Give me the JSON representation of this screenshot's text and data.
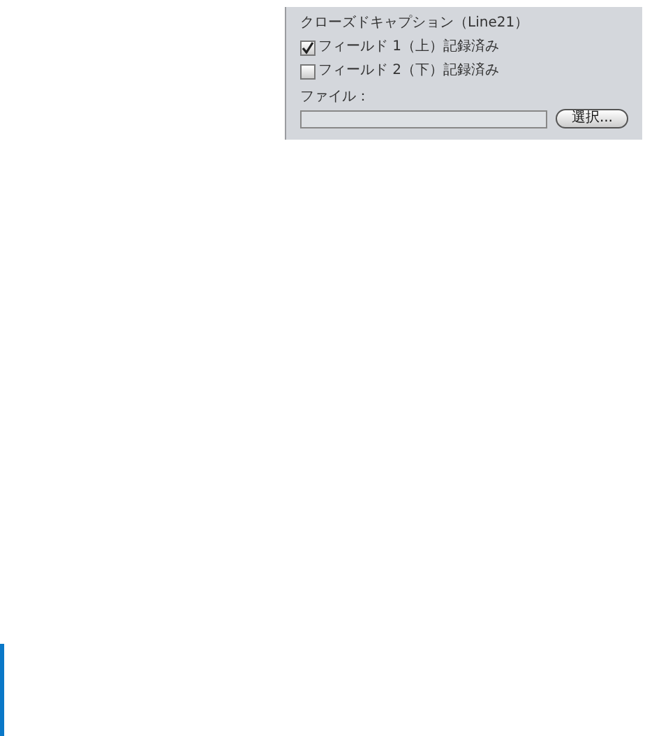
{
  "panel": {
    "title": "クローズドキャプション（Line21）",
    "options": [
      {
        "label": "フィールド 1（上）記録済み",
        "checked": true
      },
      {
        "label": "フィールド 2（下）記録済み",
        "checked": false
      }
    ],
    "file": {
      "label": "ファイル：",
      "button": "選択..."
    }
  }
}
